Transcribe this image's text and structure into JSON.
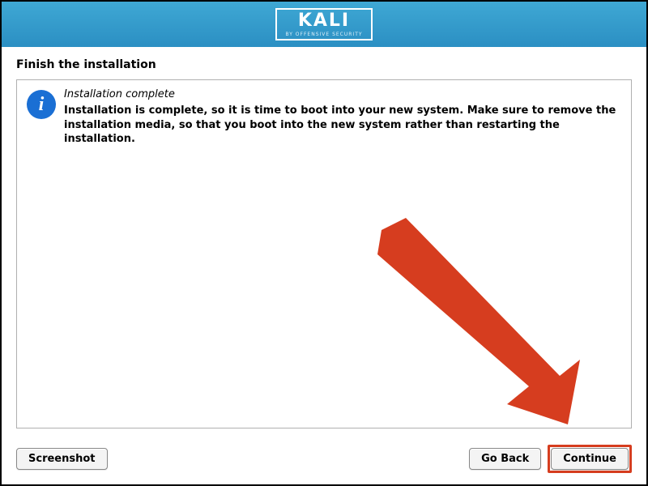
{
  "header": {
    "logo_text": "KALI",
    "logo_subtext": "BY OFFENSIVE SECURITY"
  },
  "page": {
    "title": "Finish the installation"
  },
  "message": {
    "title": "Installation complete",
    "body": "Installation is complete, so it is time to boot into your new system. Make sure to remove the installation media, so that you boot into the new system rather than restarting the installation."
  },
  "footer": {
    "screenshot_label": "Screenshot",
    "go_back_label": "Go Back",
    "continue_label": "Continue"
  },
  "colors": {
    "header_gradient_top": "#3fa8d4",
    "header_gradient_bottom": "#2b8fc3",
    "info_icon": "#1a6fd4",
    "annotation_arrow": "#d63d1f"
  }
}
